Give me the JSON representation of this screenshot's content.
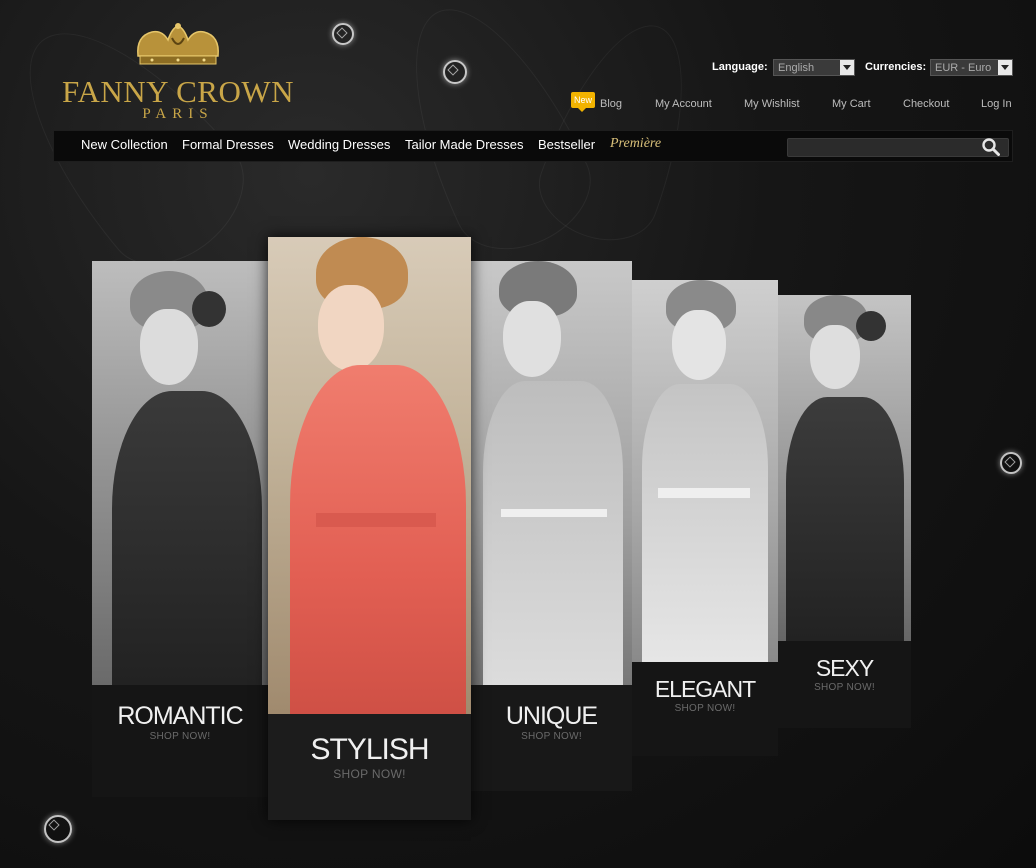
{
  "brand": {
    "name": "FANNY CROWN",
    "city": "PARIS"
  },
  "controls": {
    "language_label": "Language:",
    "language_value": "English",
    "currency_label": "Currencies:",
    "currency_value": "EUR - Euro"
  },
  "top_links": {
    "new_badge": "New",
    "blog": "Blog",
    "my_account": "My Account",
    "my_wishlist": "My Wishlist",
    "my_cart": "My Cart",
    "checkout": "Checkout",
    "log_in": "Log In"
  },
  "nav": {
    "items": [
      "New Collection",
      "Formal Dresses",
      "Wedding Dresses",
      "Tailor Made Dresses",
      "Bestseller"
    ],
    "premiere": "Première",
    "search_placeholder": ""
  },
  "panels": [
    {
      "title": "ROMANTIC",
      "shop": "SHOP NOW!"
    },
    {
      "title": "STYLISH",
      "shop": "SHOP NOW!"
    },
    {
      "title": "UNIQUE",
      "shop": "SHOP NOW!"
    },
    {
      "title": "ELEGANT",
      "shop": "SHOP NOW!"
    },
    {
      "title": "SEXY",
      "shop": "SHOP NOW!"
    }
  ],
  "colors": {
    "gold": "#c9a648",
    "badge": "#f2b300",
    "coral": "#e7685a"
  }
}
